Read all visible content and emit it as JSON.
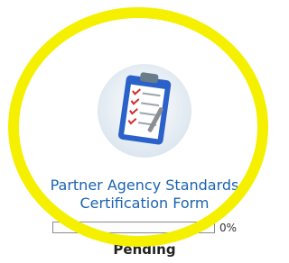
{
  "form_tile": {
    "icon": "clipboard-checklist-icon",
    "title_line1": "Partner Agency Standards",
    "title_line2": "Certification Form",
    "progress": {
      "percent_label": "0%",
      "fraction": 0
    },
    "status": "Pending"
  },
  "annotation": {
    "highlight_color": "#f5f000"
  },
  "colors": {
    "title": "#1b63b0",
    "clipboard": "#2a62c9"
  }
}
